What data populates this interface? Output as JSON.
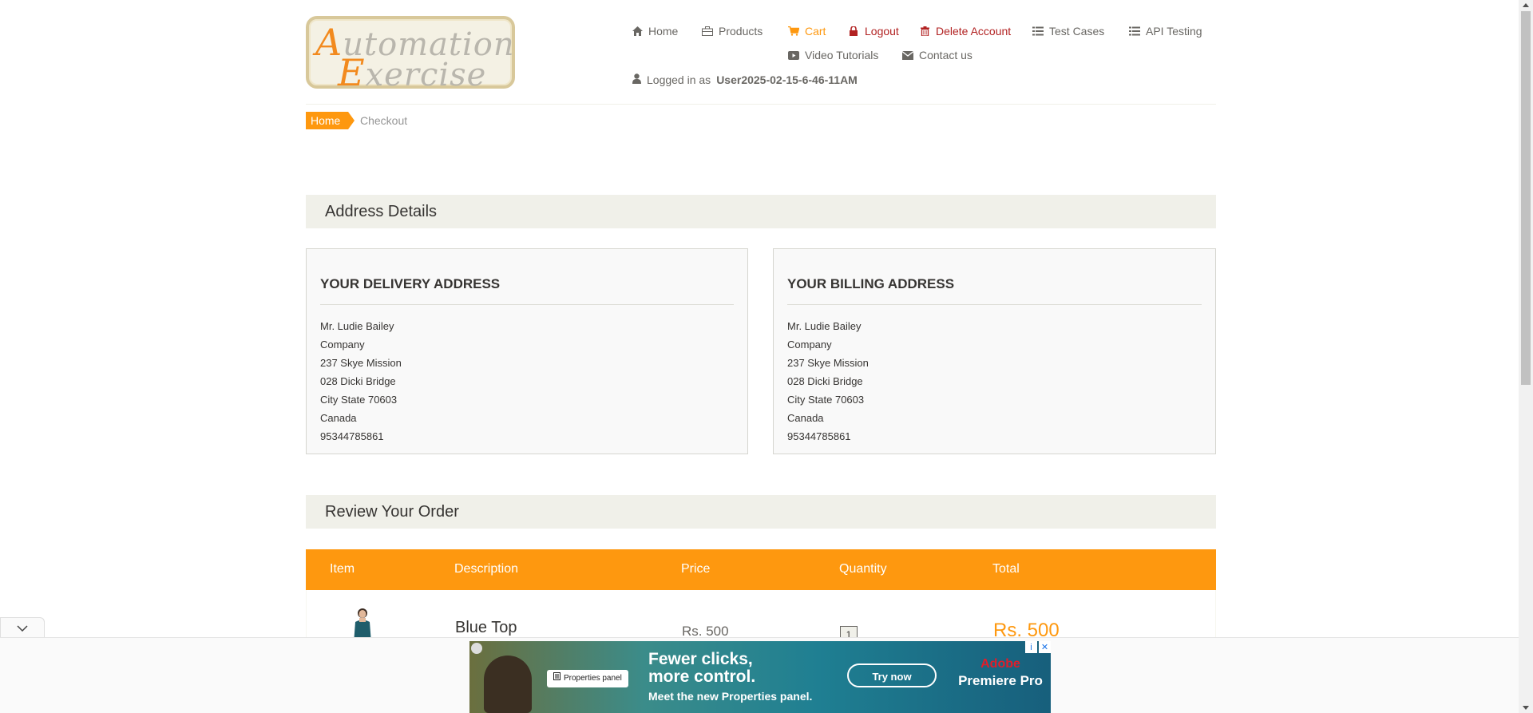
{
  "header": {
    "logo_line1": "Automation",
    "logo_line2": "Exercise",
    "nav": [
      {
        "label": "Home",
        "icon": "home-icon"
      },
      {
        "label": "Products",
        "icon": "briefcase-icon"
      },
      {
        "label": "Cart",
        "icon": "cart-icon"
      },
      {
        "label": "Logout",
        "icon": "lock-icon"
      },
      {
        "label": "Delete Account",
        "icon": "trash-icon"
      },
      {
        "label": "Test Cases",
        "icon": "list-icon"
      },
      {
        "label": "API Testing",
        "icon": "list-icon"
      },
      {
        "label": "Video Tutorials",
        "icon": "youtube-icon"
      },
      {
        "label": "Contact us",
        "icon": "envelope-icon"
      }
    ],
    "logged_prefix": "Logged in as",
    "username": "User2025-02-15-6-46-11AM"
  },
  "breadcrumb": {
    "home": "Home",
    "current": "Checkout"
  },
  "address_section": {
    "title": "Address Details",
    "delivery": {
      "heading": "YOUR DELIVERY ADDRESS",
      "lines": [
        "Mr. Ludie Bailey",
        "Company",
        "237 Skye Mission",
        "028 Dicki Bridge",
        "City State 70603",
        "Canada",
        "95344785861"
      ]
    },
    "billing": {
      "heading": "YOUR BILLING ADDRESS",
      "lines": [
        "Mr. Ludie Bailey",
        "Company",
        "237 Skye Mission",
        "028 Dicki Bridge",
        "City State 70603",
        "Canada",
        "95344785861"
      ]
    }
  },
  "order_section": {
    "title": "Review Your Order",
    "columns": [
      "Item",
      "Description",
      "Price",
      "Quantity",
      "Total"
    ],
    "rows": [
      {
        "name": "Blue Top",
        "price": "Rs. 500",
        "quantity": "1",
        "total": "Rs. 500"
      }
    ]
  },
  "ad": {
    "headline_1": "Fewer clicks,",
    "headline_2": "more control.",
    "sub": "Meet the new Properties panel.",
    "panel_label": "Properties panel",
    "cta": "Try now",
    "brand_1": "Adobe",
    "brand_2": "Premiere Pro"
  },
  "colors": {
    "accent": "#fe980f",
    "danger": "#b22222",
    "section_bg": "#f0f0e9"
  }
}
